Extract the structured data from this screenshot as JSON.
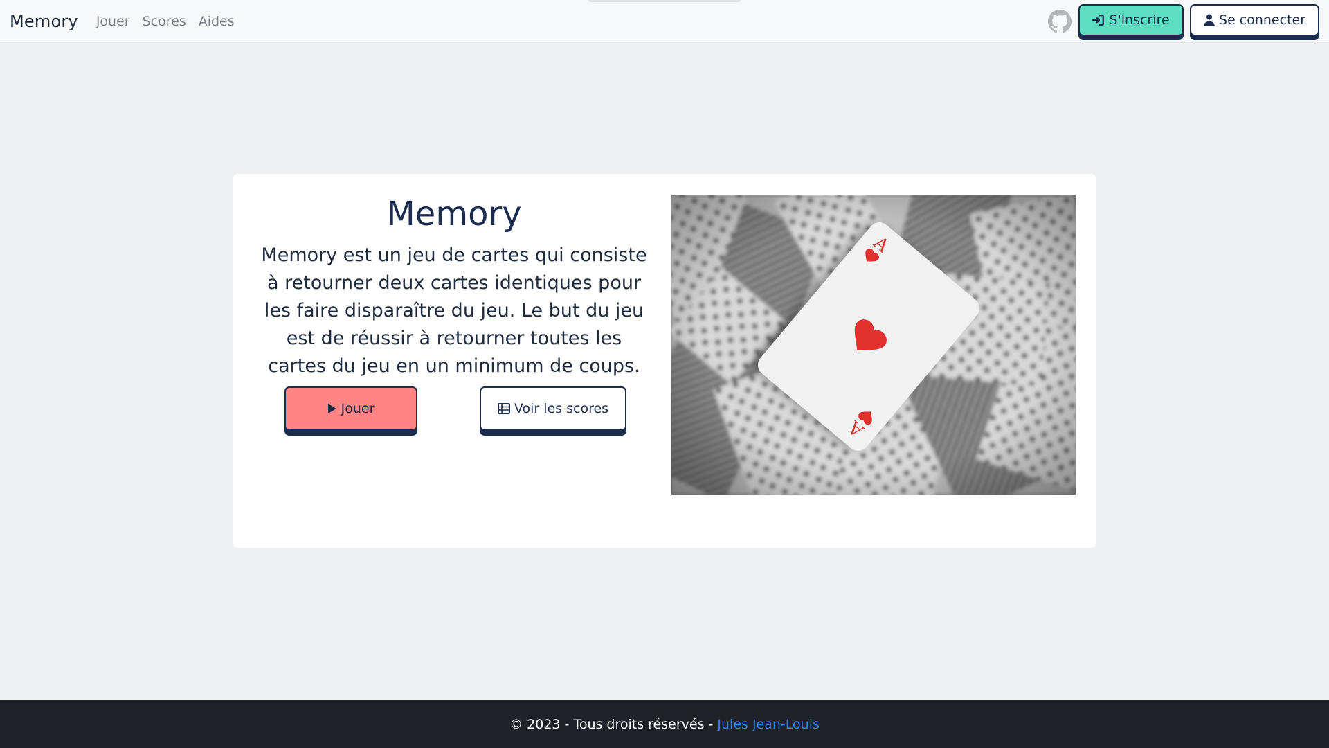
{
  "navbar": {
    "brand": "Memory",
    "links": [
      "Jouer",
      "Scores",
      "Aides"
    ],
    "github_icon": "github-icon",
    "register_label": "S'inscrire",
    "register_icon": "sign-in-icon",
    "login_label": "Se connecter",
    "login_icon": "user-icon"
  },
  "main": {
    "title": "Memory",
    "description": "Memory est un jeu de cartes qui consiste à retourner deux cartes identiques pour les faire disparaître du jeu. Le but du jeu est de réussir à retourner toutes les cartes du jeu en un minimum de coups.",
    "play_label": "Jouer",
    "play_icon": "play-icon",
    "scores_label": "Voir les scores",
    "scores_icon": "table-icon",
    "image_card_rank": "A"
  },
  "footer": {
    "text": "© 2023 - Tous droits réservés -",
    "author": "Jules Jean-Louis"
  },
  "colors": {
    "navy": "#1c2d4f",
    "mint": "#5ddec1",
    "coral": "#ff8585",
    "page_bg": "#eff0f2",
    "footer_bg": "#1f2329",
    "link_blue": "#2f7ff0",
    "heart_red": "#e0312f"
  }
}
